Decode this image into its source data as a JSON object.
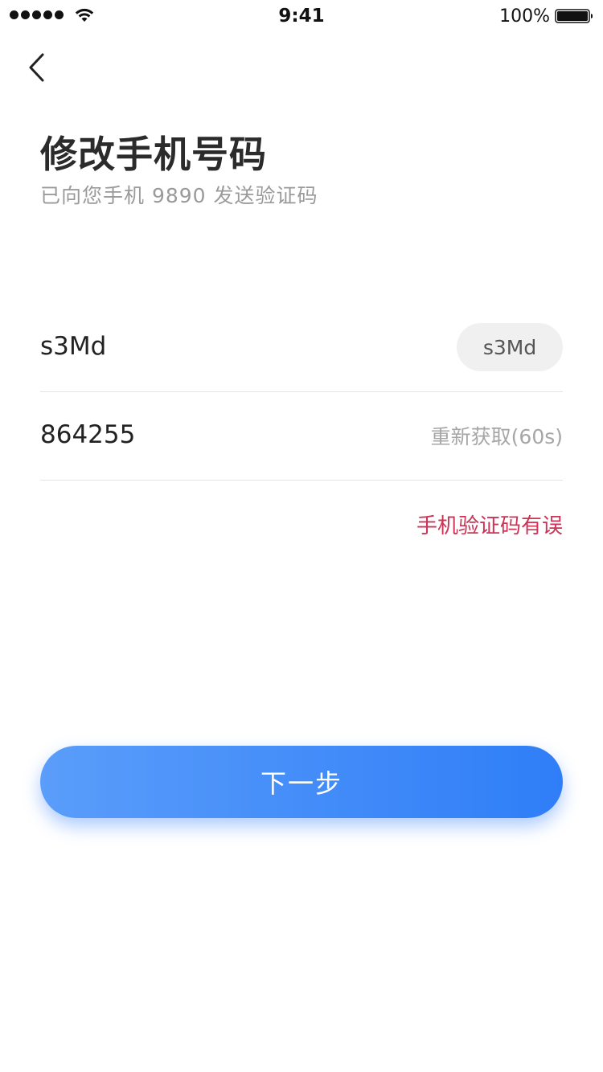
{
  "status_bar": {
    "time": "9:41",
    "battery": "100%",
    "icons": [
      "signal-dots-icon",
      "wifi-icon",
      "battery-icon"
    ]
  },
  "nav": {
    "back_icon": "chevron-left-icon"
  },
  "header": {
    "title": "修改手机号码",
    "subtitle": "已向您手机 9890 发送验证码"
  },
  "form": {
    "captcha": {
      "value": "s3Md",
      "image_text": "s3Md"
    },
    "sms_code": {
      "value": "864255",
      "resend_label": "重新获取(60s)"
    },
    "error": "手机验证码有误"
  },
  "actions": {
    "next_label": "下一步"
  },
  "colors": {
    "accent_start": "#5a9dfa",
    "accent_end": "#2f7ef8",
    "error": "#cc3355",
    "muted": "#9a9a9a"
  }
}
